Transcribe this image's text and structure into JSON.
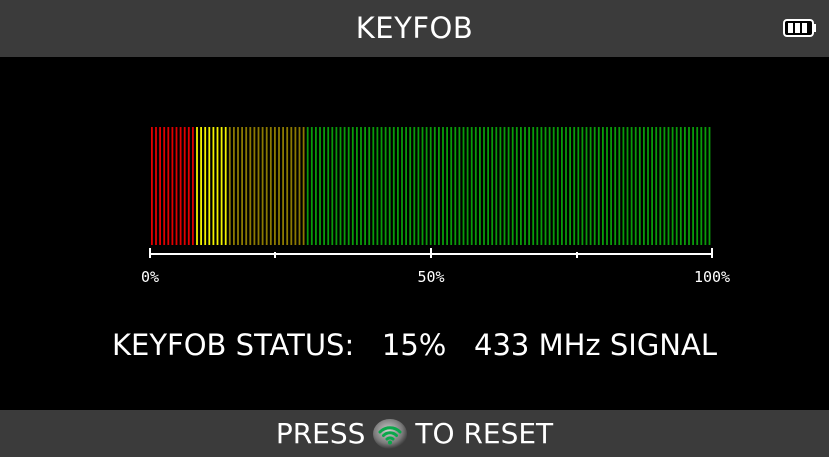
{
  "header": {
    "title": "KEYFOB",
    "battery_icon": "battery-full-icon"
  },
  "meter": {
    "signal_percent": 15,
    "zone_colors": [
      "#e00000",
      "#f2f200",
      "#8c7a00",
      "#0a9a0a"
    ],
    "scale_labels": [
      "0%",
      "50%",
      "100%"
    ]
  },
  "status": {
    "label": "KEYFOB STATUS:",
    "value": "15%",
    "signal": "433 MHz SIGNAL"
  },
  "footer": {
    "prefix": "PRESS",
    "button_icon": "wireless-button-icon",
    "suffix": "TO RESET"
  }
}
